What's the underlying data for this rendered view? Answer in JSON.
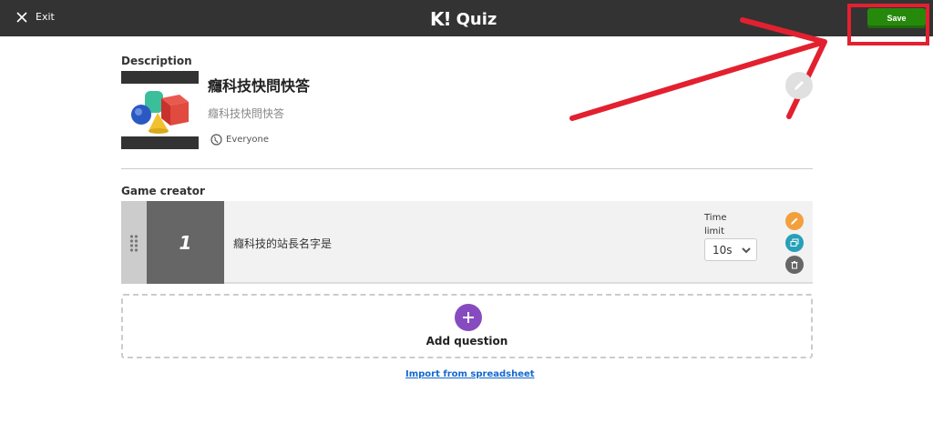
{
  "header": {
    "exit_label": "Exit",
    "logo_mark": "K!",
    "logo_text": "Quiz",
    "save_label": "Save",
    "bg_color": "#333333",
    "save_color": "#26890c",
    "annotation_color": "#e3202f"
  },
  "description": {
    "section_title": "Description",
    "title": "癮科技快問快答",
    "subtitle": "癮科技快問快答",
    "visibility": "Everyone"
  },
  "game_creator": {
    "section_title": "Game creator",
    "questions": [
      {
        "number": "1",
        "text": "癮科技的站長名字是",
        "time_limit_label": "Time limit",
        "time_value": "10s"
      }
    ],
    "add_label": "Add question",
    "import_label": "Import from spreadsheet"
  },
  "icons": {
    "exit": "close-icon",
    "edit": "pencil-icon",
    "duplicate": "duplicate-icon",
    "delete": "trash-icon",
    "add": "plus-icon",
    "visibility": "globe-icon",
    "drag": "drag-handle-icon",
    "dropdown": "chevron-down-icon"
  }
}
